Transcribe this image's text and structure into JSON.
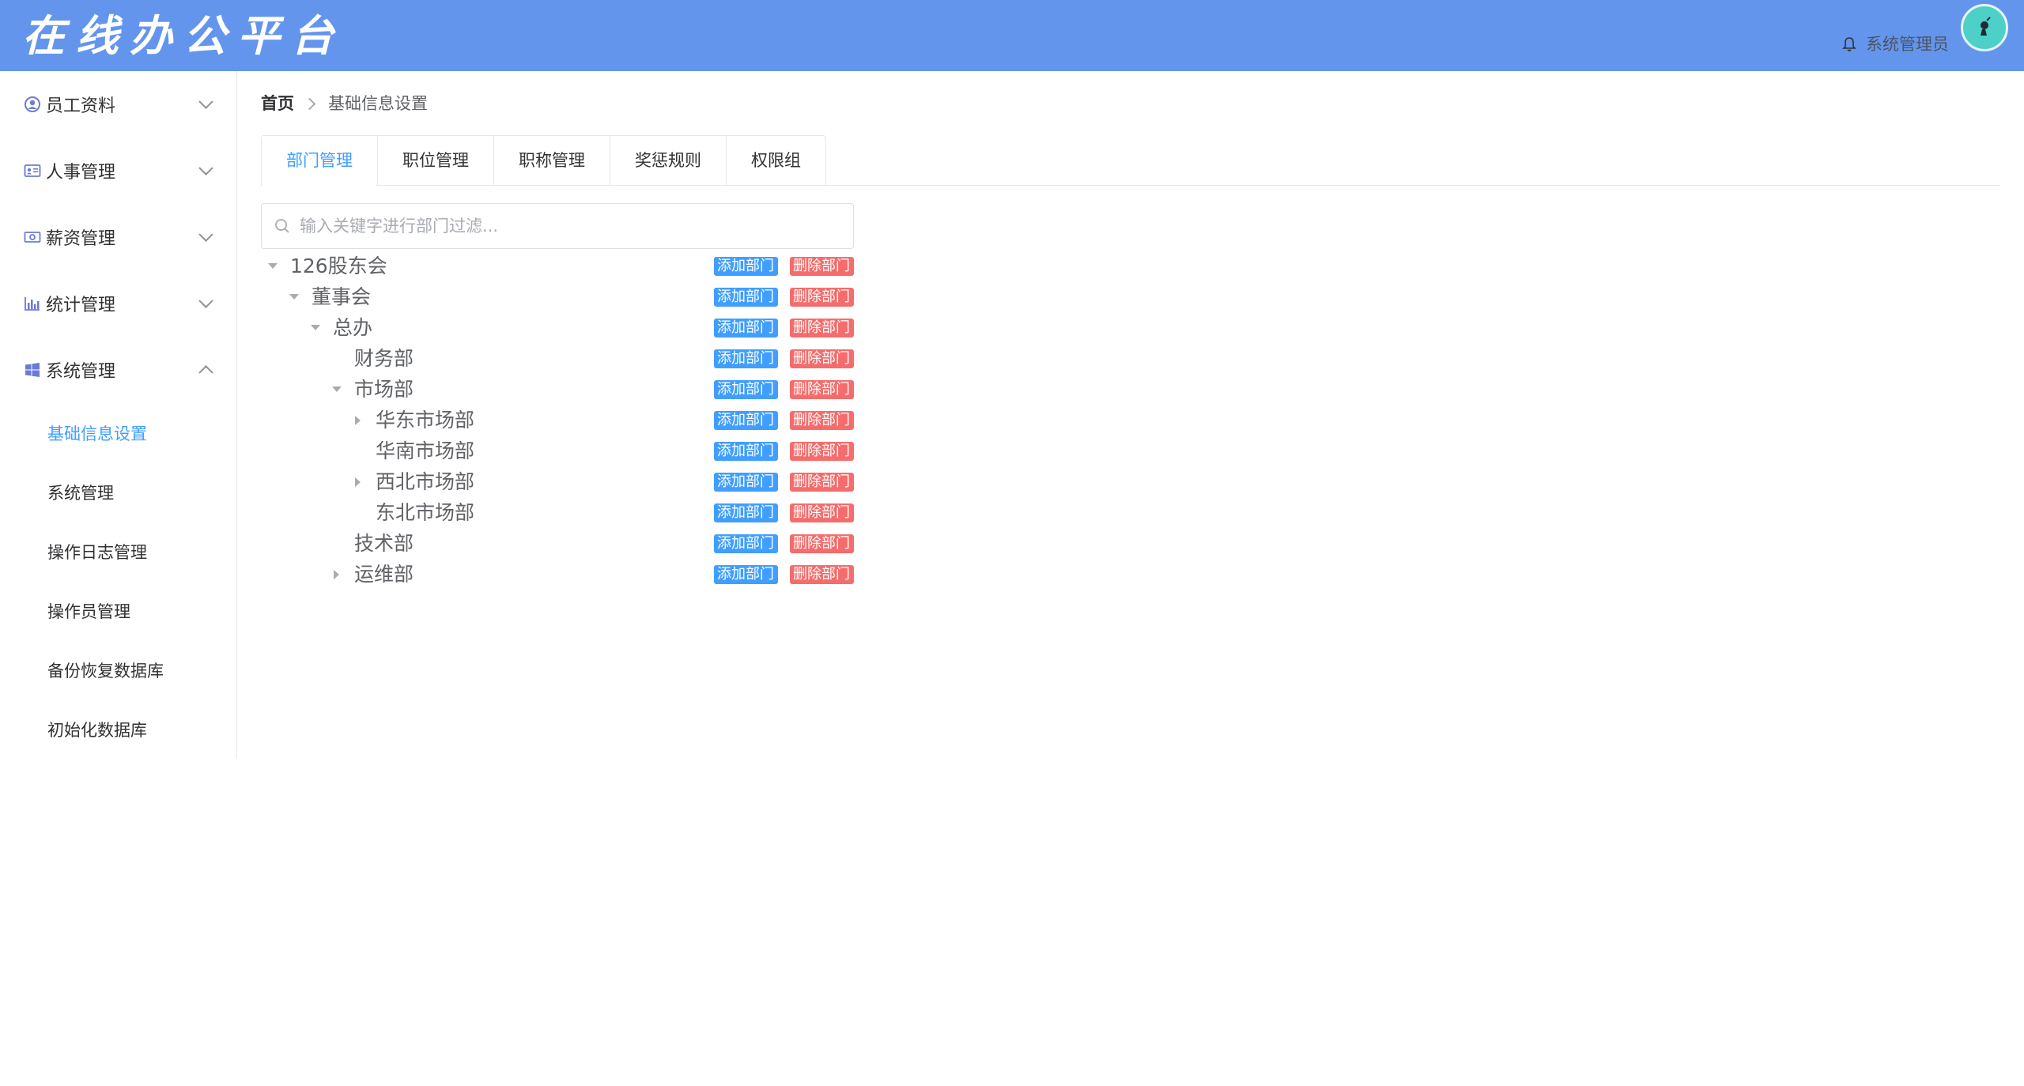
{
  "header": {
    "app_title": "在线办公平台",
    "user_name": "系统管理员",
    "bg_color": "#6495ed"
  },
  "sidebar": {
    "items": [
      {
        "label": "员工资料",
        "icon": "user-circle-icon",
        "expanded": false
      },
      {
        "label": "人事管理",
        "icon": "id-card-icon",
        "expanded": false
      },
      {
        "label": "薪资管理",
        "icon": "money-icon",
        "expanded": false
      },
      {
        "label": "统计管理",
        "icon": "bar-chart-icon",
        "expanded": false
      },
      {
        "label": "系统管理",
        "icon": "windows-icon",
        "expanded": true
      }
    ],
    "sub_items": [
      {
        "label": "基础信息设置",
        "active": true
      },
      {
        "label": "系统管理",
        "active": false
      },
      {
        "label": "操作日志管理",
        "active": false
      },
      {
        "label": "操作员管理",
        "active": false
      },
      {
        "label": "备份恢复数据库",
        "active": false
      },
      {
        "label": "初始化数据库",
        "active": false
      }
    ]
  },
  "breadcrumb": {
    "home": "首页",
    "current": "基础信息设置"
  },
  "tabs": [
    {
      "label": "部门管理",
      "active": true
    },
    {
      "label": "职位管理",
      "active": false
    },
    {
      "label": "职称管理",
      "active": false
    },
    {
      "label": "奖惩规则",
      "active": false
    },
    {
      "label": "权限组",
      "active": false
    }
  ],
  "search": {
    "placeholder": "输入关键字进行部门过滤...",
    "value": ""
  },
  "tree": {
    "add_label": "添加部门",
    "delete_label": "删除部门",
    "nodes": [
      {
        "label": "126股东会",
        "level": 0,
        "arrow": "down"
      },
      {
        "label": "董事会",
        "level": 1,
        "arrow": "down"
      },
      {
        "label": "总办",
        "level": 2,
        "arrow": "down"
      },
      {
        "label": "财务部",
        "level": 3,
        "arrow": "none"
      },
      {
        "label": "市场部",
        "level": 3,
        "arrow": "down"
      },
      {
        "label": "华东市场部",
        "level": 4,
        "arrow": "right"
      },
      {
        "label": "华南市场部",
        "level": 4,
        "arrow": "none"
      },
      {
        "label": "西北市场部",
        "level": 4,
        "arrow": "right"
      },
      {
        "label": "东北市场部",
        "level": 4,
        "arrow": "none"
      },
      {
        "label": "技术部",
        "level": 3,
        "arrow": "none"
      },
      {
        "label": "运维部",
        "level": 3,
        "arrow": "right"
      }
    ]
  },
  "colors": {
    "primary": "#409eff",
    "danger": "#f56c6c",
    "header": "#6495ed"
  }
}
